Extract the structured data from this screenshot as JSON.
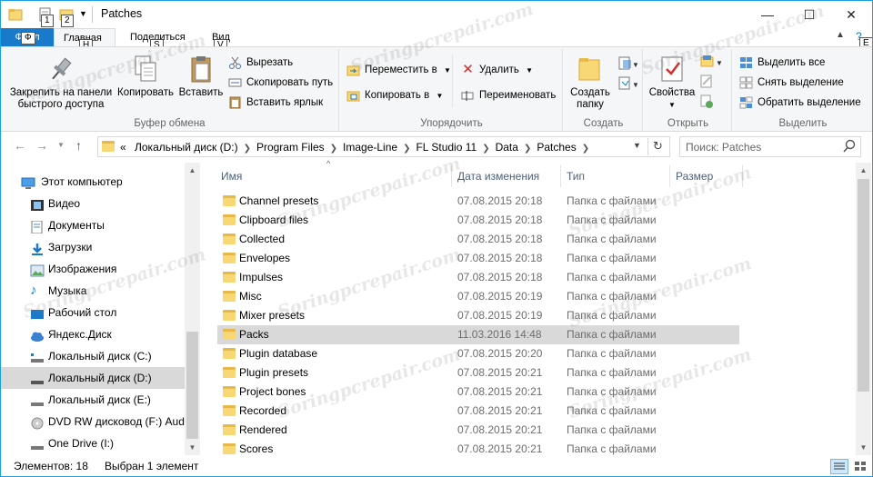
{
  "window": {
    "title": "Patches",
    "keytips": [
      "1",
      "2",
      "H",
      "S",
      "V",
      "E"
    ],
    "controls": {
      "minimize": "—",
      "maximize": "☐",
      "close": "✕"
    }
  },
  "ribbon_tabs": {
    "file": "Файл",
    "file_keytip": "Ф",
    "home": "Главная",
    "share": "Поделиться",
    "view": "Вид"
  },
  "ribbon": {
    "clipboard": {
      "pin": "Закрепить на панели быстрого доступа",
      "pin_l1": "Закрепить на панели",
      "pin_l2": "быстрого доступа",
      "copy": "Копировать",
      "paste": "Вставить",
      "cut": "Вырезать",
      "copy_path": "Скопировать путь",
      "paste_shortcut": "Вставить ярлык",
      "label": "Буфер обмена"
    },
    "organize": {
      "move_to": "Переместить в",
      "copy_to": "Копировать в",
      "delete": "Удалить",
      "rename": "Переименовать",
      "label": "Упорядочить"
    },
    "new": {
      "new_folder_l1": "Создать",
      "new_folder_l2": "папку",
      "label": "Создать"
    },
    "open": {
      "properties": "Свойства",
      "label": "Открыть"
    },
    "select": {
      "select_all": "Выделить все",
      "select_none": "Снять выделение",
      "invert": "Обратить выделение",
      "label": "Выделить"
    }
  },
  "address": {
    "overflow": "«",
    "crumbs": [
      "Локальный диск (D:)",
      "Program Files",
      "Image-Line",
      "FL Studio 11",
      "Data",
      "Patches"
    ],
    "search_placeholder": "Поиск: Patches"
  },
  "nav_pane": [
    {
      "label": "Этот компьютер",
      "icon": "computer-icon",
      "selected": false
    },
    {
      "label": "Видео",
      "icon": "video-icon",
      "selected": false
    },
    {
      "label": "Документы",
      "icon": "documents-icon",
      "selected": false
    },
    {
      "label": "Загрузки",
      "icon": "downloads-icon",
      "selected": false
    },
    {
      "label": "Изображения",
      "icon": "pictures-icon",
      "selected": false
    },
    {
      "label": "Музыка",
      "icon": "music-icon",
      "selected": false
    },
    {
      "label": "Рабочий стол",
      "icon": "desktop-icon",
      "selected": false
    },
    {
      "label": "Яндекс.Диск",
      "icon": "cloud-icon",
      "selected": false
    },
    {
      "label": "Локальный диск (C:)",
      "icon": "drive-icon",
      "selected": false
    },
    {
      "label": "Локальный диск (D:)",
      "icon": "drive-icon",
      "selected": true
    },
    {
      "label": "Локальный диск (E:)",
      "icon": "drive-icon",
      "selected": false
    },
    {
      "label": "DVD RW дисковод (F:) Audio",
      "icon": "dvd-icon",
      "selected": false
    },
    {
      "label": "One Drive (I:)",
      "icon": "drive-icon",
      "selected": false
    }
  ],
  "columns": {
    "name": "Имя",
    "date": "Дата изменения",
    "type": "Тип",
    "size": "Размер"
  },
  "files": [
    {
      "name": "Channel presets",
      "date": "07.08.2015 20:18",
      "type": "Папка с файлами",
      "selected": false
    },
    {
      "name": "Clipboard files",
      "date": "07.08.2015 20:18",
      "type": "Папка с файлами",
      "selected": false
    },
    {
      "name": "Collected",
      "date": "07.08.2015 20:18",
      "type": "Папка с файлами",
      "selected": false
    },
    {
      "name": "Envelopes",
      "date": "07.08.2015 20:18",
      "type": "Папка с файлами",
      "selected": false
    },
    {
      "name": "Impulses",
      "date": "07.08.2015 20:18",
      "type": "Папка с файлами",
      "selected": false
    },
    {
      "name": "Misc",
      "date": "07.08.2015 20:19",
      "type": "Папка с файлами",
      "selected": false
    },
    {
      "name": "Mixer presets",
      "date": "07.08.2015 20:19",
      "type": "Папка с файлами",
      "selected": false
    },
    {
      "name": "Packs",
      "date": "11.03.2016 14:48",
      "type": "Папка с файлами",
      "selected": true
    },
    {
      "name": "Plugin database",
      "date": "07.08.2015 20:20",
      "type": "Папка с файлами",
      "selected": false
    },
    {
      "name": "Plugin presets",
      "date": "07.08.2015 20:21",
      "type": "Папка с файлами",
      "selected": false
    },
    {
      "name": "Project bones",
      "date": "07.08.2015 20:21",
      "type": "Папка с файлами",
      "selected": false
    },
    {
      "name": "Recorded",
      "date": "07.08.2015 20:21",
      "type": "Папка с файлами",
      "selected": false
    },
    {
      "name": "Rendered",
      "date": "07.08.2015 20:21",
      "type": "Папка с файлами",
      "selected": false
    },
    {
      "name": "Scores",
      "date": "07.08.2015 20:21",
      "type": "Папка с файлами",
      "selected": false
    }
  ],
  "status": {
    "items": "Элементов: 18",
    "selected": "Выбран 1 элемент"
  },
  "watermark": "Soringpcrepair.com",
  "colors": {
    "accent": "#1979ca",
    "border": "#1ba1e2",
    "selection": "#d9d9d9",
    "nav_selection": "#cce8ff",
    "folder": "#f8d775"
  }
}
